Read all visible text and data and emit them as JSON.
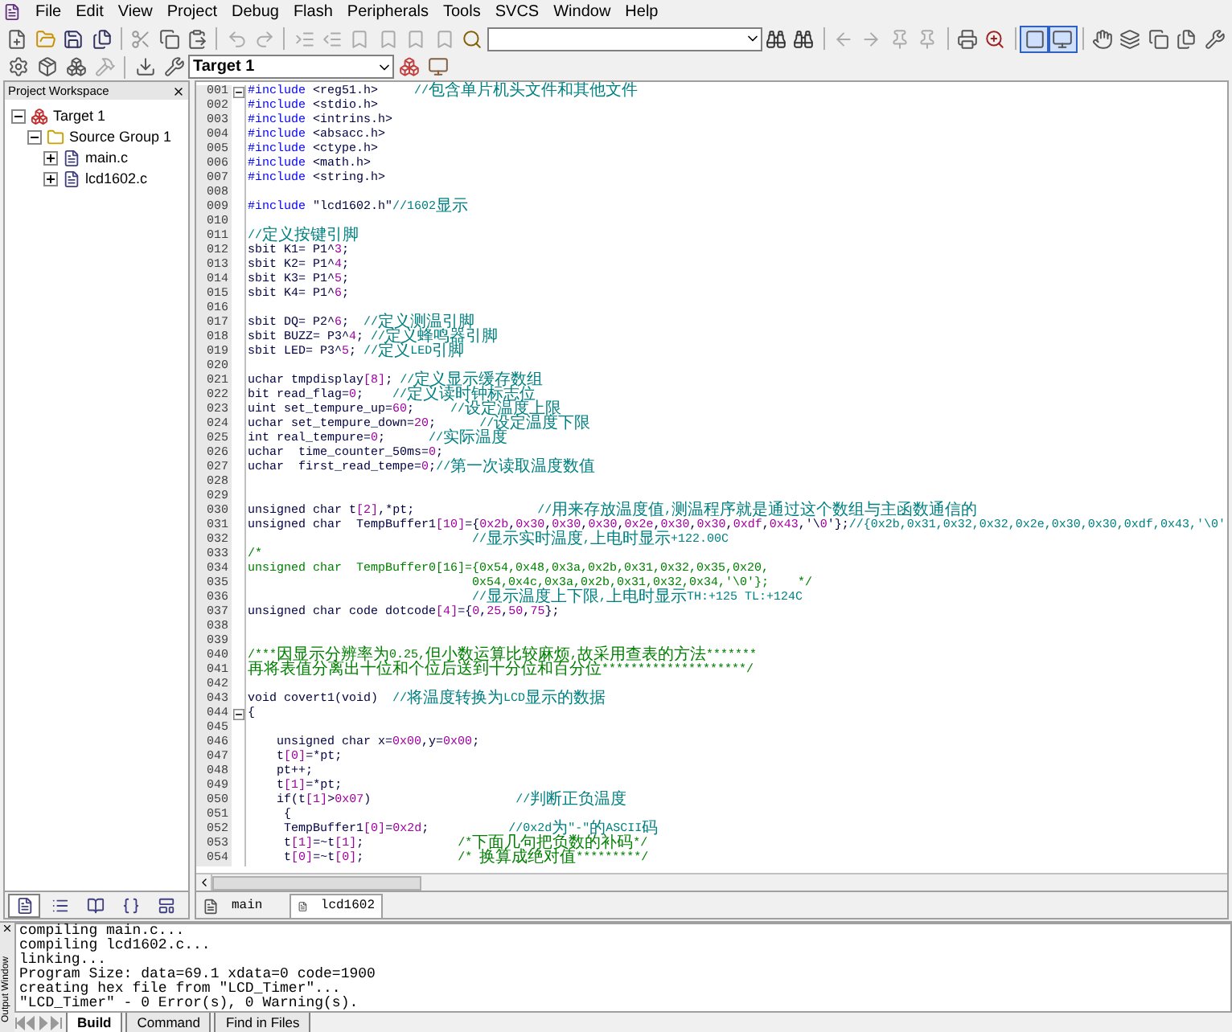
{
  "menu": {
    "items": [
      "File",
      "Edit",
      "View",
      "Project",
      "Debug",
      "Flash",
      "Peripherals",
      "Tools",
      "SVCS",
      "Window",
      "Help"
    ]
  },
  "toolbar": {
    "target": "Target 1"
  },
  "workspace": {
    "title": "Project Workspace",
    "tree": [
      {
        "label": "Target 1",
        "kind": "target",
        "expanded": true,
        "children": [
          {
            "label": "Source Group 1",
            "kind": "group",
            "expanded": true,
            "children": [
              {
                "label": "main.c",
                "kind": "file",
                "expanded": false
              },
              {
                "label": "lcd1602.c",
                "kind": "file",
                "expanded": false
              }
            ]
          }
        ]
      }
    ],
    "tabs": [
      {
        "kind": "files",
        "selected": true
      },
      {
        "kind": "registers",
        "selected": false
      },
      {
        "kind": "books",
        "selected": false
      },
      {
        "kind": "functions",
        "selected": false
      },
      {
        "kind": "templates",
        "selected": false
      }
    ]
  },
  "editor": {
    "lines": [
      {
        "number": "001",
        "fold": true,
        "segments": [
          {
            "kind": "code",
            "text": "#include <reg51.h>     "
          },
          {
            "kind": "line_comment",
            "text": "//包含单片机头文件和其他文件"
          }
        ]
      },
      {
        "number": "002",
        "fold": false,
        "segments": [
          {
            "kind": "code",
            "text": "#include <stdio.h>"
          }
        ]
      },
      {
        "number": "003",
        "fold": false,
        "segments": [
          {
            "kind": "code",
            "text": "#include <intrins.h>"
          }
        ]
      },
      {
        "number": "004",
        "fold": false,
        "segments": [
          {
            "kind": "code",
            "text": "#include <absacc.h>"
          }
        ]
      },
      {
        "number": "005",
        "fold": false,
        "segments": [
          {
            "kind": "code",
            "text": "#include <ctype.h>"
          }
        ]
      },
      {
        "number": "006",
        "fold": false,
        "segments": [
          {
            "kind": "code",
            "text": "#include <math.h>"
          }
        ]
      },
      {
        "number": "007",
        "fold": false,
        "segments": [
          {
            "kind": "code",
            "text": "#include <string.h>"
          }
        ]
      },
      {
        "number": "008",
        "fold": false
      },
      {
        "number": "009",
        "fold": false,
        "segments": [
          {
            "kind": "code",
            "text": "#include \"lcd1602.h\""
          },
          {
            "kind": "line_comment",
            "text": "//1602显示"
          }
        ]
      },
      {
        "number": "010",
        "fold": false
      },
      {
        "number": "011",
        "fold": false,
        "segments": [
          {
            "kind": "line_comment",
            "text": "//定义按键引脚"
          }
        ]
      },
      {
        "number": "012",
        "fold": false,
        "segments": [
          {
            "kind": "code",
            "text": "sbit K1= P1^3;"
          }
        ]
      },
      {
        "number": "013",
        "fold": false,
        "segments": [
          {
            "kind": "code",
            "text": "sbit K2= P1^4;"
          }
        ]
      },
      {
        "number": "014",
        "fold": false,
        "segments": [
          {
            "kind": "code",
            "text": "sbit K3= P1^5;"
          }
        ]
      },
      {
        "number": "015",
        "fold": false,
        "segments": [
          {
            "kind": "code",
            "text": "sbit K4= P1^6;"
          }
        ]
      },
      {
        "number": "016",
        "fold": false
      },
      {
        "number": "017",
        "fold": false,
        "segments": [
          {
            "kind": "code",
            "text": "sbit DQ= P2^6;  "
          },
          {
            "kind": "line_comment",
            "text": "//定义测温引脚"
          }
        ]
      },
      {
        "number": "018",
        "fold": false,
        "segments": [
          {
            "kind": "code",
            "text": "sbit BUZZ= P3^4; "
          },
          {
            "kind": "line_comment",
            "text": "//定义蜂鸣器引脚"
          }
        ]
      },
      {
        "number": "019",
        "fold": false,
        "segments": [
          {
            "kind": "code",
            "text": "sbit LED= P3^5; "
          },
          {
            "kind": "line_comment",
            "text": "//定义LED引脚"
          }
        ]
      },
      {
        "number": "020",
        "fold": false
      },
      {
        "number": "021",
        "fold": false,
        "segments": [
          {
            "kind": "code",
            "text": "uchar tmpdisplay[8]; "
          },
          {
            "kind": "line_comment",
            "text": "//定义显示缓存数组"
          }
        ]
      },
      {
        "number": "022",
        "fold": false,
        "segments": [
          {
            "kind": "code",
            "text": "bit read_flag=0;    "
          },
          {
            "kind": "line_comment",
            "text": "//定义读时钟标志位"
          }
        ]
      },
      {
        "number": "023",
        "fold": false,
        "segments": [
          {
            "kind": "code",
            "text": "uint set_tempure_up=60;     "
          },
          {
            "kind": "line_comment",
            "text": "//设定温度上限"
          }
        ]
      },
      {
        "number": "024",
        "fold": false,
        "segments": [
          {
            "kind": "code",
            "text": "uchar set_tempure_down=20;      "
          },
          {
            "kind": "line_comment",
            "text": "//设定温度下限"
          }
        ]
      },
      {
        "number": "025",
        "fold": false,
        "segments": [
          {
            "kind": "code",
            "text": "int real_tempure=0;      "
          },
          {
            "kind": "line_comment",
            "text": "//实际温度"
          }
        ]
      },
      {
        "number": "026",
        "fold": false,
        "segments": [
          {
            "kind": "code",
            "text": "uchar  time_counter_50ms=0;"
          }
        ]
      },
      {
        "number": "027",
        "fold": false,
        "segments": [
          {
            "kind": "code",
            "text": "uchar  first_read_tempe=0;"
          },
          {
            "kind": "line_comment",
            "text": "//第一次读取温度数值"
          }
        ]
      },
      {
        "number": "028",
        "fold": false
      },
      {
        "number": "029",
        "fold": false
      },
      {
        "number": "030",
        "fold": false,
        "segments": [
          {
            "kind": "code",
            "text": "unsigned char t[2],*pt;                 "
          },
          {
            "kind": "line_comment",
            "text": "//用来存放温度值,测温程序就是通过这个数组与主函数通信的"
          }
        ]
      },
      {
        "number": "031",
        "fold": false,
        "segments": [
          {
            "kind": "code",
            "text": "unsigned char  TempBuffer1[10]={0x2b,0x30,0x30,0x30,0x2e,0x30,0x30,0xdf,0x43,'\\0'};"
          },
          {
            "kind": "line_comment",
            "text": "//{0x2b,0x31,0x32,0x32,0x2e,0x30,0x30,0xdf,0x43,'\\0'"
          }
        ]
      },
      {
        "number": "032",
        "fold": false,
        "segments": [
          {
            "kind": "line_comment",
            "text": "                               //显示实时温度,上电时显示+122.00C"
          }
        ]
      },
      {
        "number": "033",
        "fold": false,
        "segments": [
          {
            "kind": "block_comment",
            "text": "/*"
          }
        ]
      },
      {
        "number": "034",
        "fold": false,
        "segments": [
          {
            "kind": "block_comment",
            "text": "unsigned char  TempBuffer0[16]={0x54,0x48,0x3a,0x2b,0x31,0x32,0x35,0x20,"
          }
        ]
      },
      {
        "number": "035",
        "fold": false,
        "segments": [
          {
            "kind": "block_comment",
            "text": "                               0x54,0x4c,0x3a,0x2b,0x31,0x32,0x34,'\\0'};    */"
          }
        ]
      },
      {
        "number": "036",
        "fold": false,
        "segments": [
          {
            "kind": "line_comment",
            "text": "                               //显示温度上下限,上电时显示TH:+125 TL:+124C"
          }
        ]
      },
      {
        "number": "037",
        "fold": false,
        "segments": [
          {
            "kind": "code",
            "text": "unsigned char code dotcode[4]={0,25,50,75};"
          }
        ]
      },
      {
        "number": "038",
        "fold": false
      },
      {
        "number": "039",
        "fold": false
      },
      {
        "number": "040",
        "fold": false,
        "segments": [
          {
            "kind": "block_comment",
            "text": "/***因显示分辨率为0.25,但小数运算比较麻烦,故采用查表的方法*******"
          }
        ]
      },
      {
        "number": "041",
        "fold": false,
        "segments": [
          {
            "kind": "block_comment",
            "text": "再将表值分离出十位和个位后送到十分位和百分位********************/"
          }
        ]
      },
      {
        "number": "042",
        "fold": false
      },
      {
        "number": "043",
        "fold": false,
        "segments": [
          {
            "kind": "code",
            "text": "void covert1(void)  "
          },
          {
            "kind": "line_comment",
            "text": "//将温度转换为LCD显示的数据"
          }
        ]
      },
      {
        "number": "044",
        "fold": true,
        "segments": [
          {
            "kind": "code",
            "text": "{"
          }
        ]
      },
      {
        "number": "045",
        "fold": false
      },
      {
        "number": "046",
        "fold": false,
        "segments": [
          {
            "kind": "code",
            "text": "    unsigned char x=0x00,y=0x00;"
          }
        ]
      },
      {
        "number": "047",
        "fold": false,
        "segments": [
          {
            "kind": "code",
            "text": "    t[0]=*pt;"
          }
        ]
      },
      {
        "number": "048",
        "fold": false,
        "segments": [
          {
            "kind": "code",
            "text": "    pt++;"
          }
        ]
      },
      {
        "number": "049",
        "fold": false,
        "segments": [
          {
            "kind": "code",
            "text": "    t[1]=*pt;"
          }
        ]
      },
      {
        "number": "050",
        "fold": false,
        "segments": [
          {
            "kind": "code",
            "text": "    if(t[1]>0x07)                    "
          },
          {
            "kind": "line_comment",
            "text": "//判断正负温度"
          }
        ]
      },
      {
        "number": "051",
        "fold": false,
        "segments": [
          {
            "kind": "code",
            "text": "     {"
          }
        ]
      },
      {
        "number": "052",
        "fold": false,
        "segments": [
          {
            "kind": "code",
            "text": "     TempBuffer1[0]=0x2d;           "
          },
          {
            "kind": "line_comment",
            "text": "//0x2d为\"-\"的ASCII码"
          }
        ]
      },
      {
        "number": "053",
        "fold": false,
        "segments": [
          {
            "kind": "code",
            "text": "     t[1]=~t[1];             "
          },
          {
            "kind": "block_comment",
            "text": "/*下面几句把负数的补码*/"
          }
        ]
      },
      {
        "number": "054",
        "fold": false,
        "segments": [
          {
            "kind": "code",
            "text": "     t[0]=~t[0];             "
          },
          {
            "kind": "block_comment",
            "text": "/* 换算成绝对值*********/"
          }
        ]
      }
    ],
    "tabs": [
      {
        "label": "main",
        "selected": false
      },
      {
        "label": "lcd1602",
        "selected": true
      }
    ]
  },
  "output": {
    "title": "Output Window",
    "lines": [
      "compiling main.c...",
      "compiling lcd1602.c...",
      "linking...",
      "Program Size: data=69.1 xdata=0 code=1900",
      "creating hex file from \"LCD_Timer\"...",
      "\"LCD_Timer\" - 0 Error(s), 0 Warning(s)."
    ],
    "tabs": [
      {
        "label": "Build",
        "selected": true
      },
      {
        "label": "Command",
        "selected": false
      },
      {
        "label": "Find in Files",
        "selected": false
      }
    ]
  }
}
